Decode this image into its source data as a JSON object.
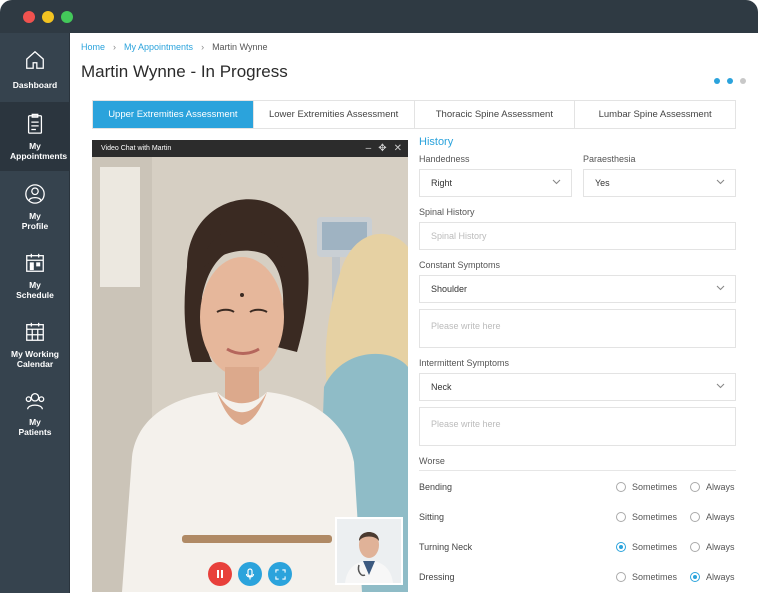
{
  "sidebar": {
    "items": [
      {
        "label": "Dashboard",
        "icon": "home-icon"
      },
      {
        "label": "My Appointments",
        "icon": "clipboard-icon",
        "active": true
      },
      {
        "label": "My Profile",
        "icon": "user-circle-icon"
      },
      {
        "label": "My Schedule",
        "icon": "calendar-icon"
      },
      {
        "label": "My Working Calendar",
        "icon": "calendar-grid-icon"
      },
      {
        "label": "My Patients",
        "icon": "users-icon"
      }
    ]
  },
  "breadcrumb": {
    "home": "Home",
    "appointments": "My Appointments",
    "current": "Martin Wynne"
  },
  "page_title": "Martin Wynne - In Progress",
  "pager": {
    "total": 3,
    "active": 2
  },
  "tabs": [
    {
      "label": "Upper Extremities Assessment",
      "active": true
    },
    {
      "label": "Lower Extremities Assessment"
    },
    {
      "label": "Thoracic Spine Assessment"
    },
    {
      "label": "Lumbar Spine Assessment"
    }
  ],
  "video": {
    "title": "Video Chat with Martin"
  },
  "form": {
    "section": "History",
    "handedness": {
      "label": "Handedness",
      "value": "Right"
    },
    "paraesthesia": {
      "label": "Paraesthesia",
      "value": "Yes"
    },
    "spinal_history": {
      "label": "Spinal History",
      "placeholder": "Spinal History"
    },
    "constant": {
      "label": "Constant Symptoms",
      "value": "Shoulder",
      "placeholder": "Please write here"
    },
    "intermittent": {
      "label": "Intermittent Symptoms",
      "value": "Neck",
      "placeholder": "Please write here"
    },
    "worse": {
      "label": "Worse",
      "opt_a": "Sometimes",
      "opt_b": "Always",
      "rows": [
        {
          "name": "Bending",
          "selected": ""
        },
        {
          "name": "Sitting",
          "selected": ""
        },
        {
          "name": "Turning Neck",
          "selected": "Sometimes"
        },
        {
          "name": "Dressing",
          "selected": "Always"
        }
      ]
    }
  },
  "colors": {
    "accent": "#2ba3dc",
    "sidebar": "#36434e",
    "end_call": "#e8403b"
  }
}
